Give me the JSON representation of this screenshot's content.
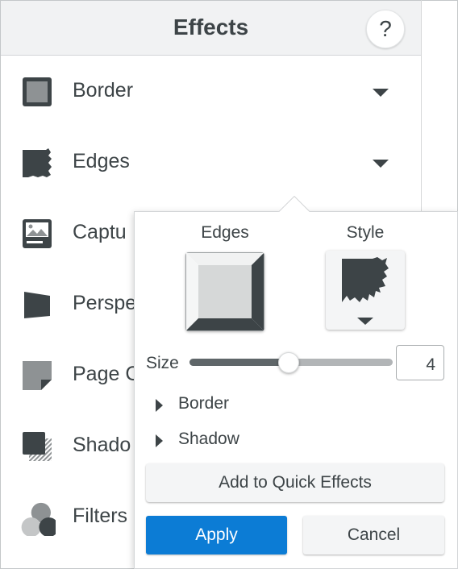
{
  "panel": {
    "title": "Effects",
    "help_label": "?"
  },
  "effects": [
    {
      "label": "Border",
      "icon": "border-effect-icon",
      "has_dropdown": true
    },
    {
      "label": "Edges",
      "icon": "edges-effect-icon",
      "has_dropdown": true
    },
    {
      "label": "Captu",
      "icon": "caption-effect-icon",
      "has_dropdown": false
    },
    {
      "label": "Perspe",
      "icon": "perspective-effect-icon",
      "has_dropdown": false
    },
    {
      "label": "Page C",
      "icon": "page-curl-effect-icon",
      "has_dropdown": false
    },
    {
      "label": "Shado",
      "icon": "shadow-effect-icon",
      "has_dropdown": false
    },
    {
      "label": "Filters",
      "icon": "filters-effect-icon",
      "has_dropdown": false
    }
  ],
  "popover": {
    "edges_label": "Edges",
    "style_label": "Style",
    "size_label": "Size",
    "size_value": "4",
    "size_slider_fraction": 0.49,
    "sections": [
      {
        "label": "Border"
      },
      {
        "label": "Shadow"
      }
    ],
    "quick_effects_label": "Add to Quick Effects",
    "apply_label": "Apply",
    "cancel_label": "Cancel"
  },
  "colors": {
    "accent": "#0c7cd5",
    "icon_dark": "#3d4447",
    "icon_gray": "#8e9294",
    "header_bg": "#f1f2f3"
  }
}
